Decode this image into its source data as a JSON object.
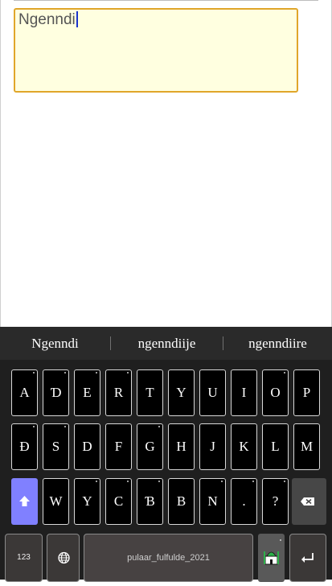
{
  "editor": {
    "text": "Ngenndi"
  },
  "suggestions": [
    "Ngenndi",
    "ngenndiije",
    "ngenndiire"
  ],
  "keyboard": {
    "row1": [
      "A",
      "Ɗ",
      "E",
      "R",
      "T",
      "Y",
      "U",
      "I",
      "O",
      "P"
    ],
    "row2": [
      "Ɖ",
      "S",
      "D",
      "F",
      "G",
      "H",
      "J",
      "K",
      "L",
      "M"
    ],
    "row3": [
      "W",
      "Y",
      "C",
      "Ɓ",
      "B",
      "N",
      ".",
      "?"
    ],
    "numbers_label": "123",
    "space_label": "pulaar_fulfulde_2021",
    "icons": {
      "shift": "shift-arrow-icon",
      "backspace": "backspace-icon",
      "globe": "globe-icon",
      "ime": "mosque-keyboard-icon",
      "enter": "enter-icon"
    },
    "colors": {
      "shift": "#8080ff",
      "editor_bg": "#ffffe0",
      "editor_border": "#e0a62a"
    }
  }
}
